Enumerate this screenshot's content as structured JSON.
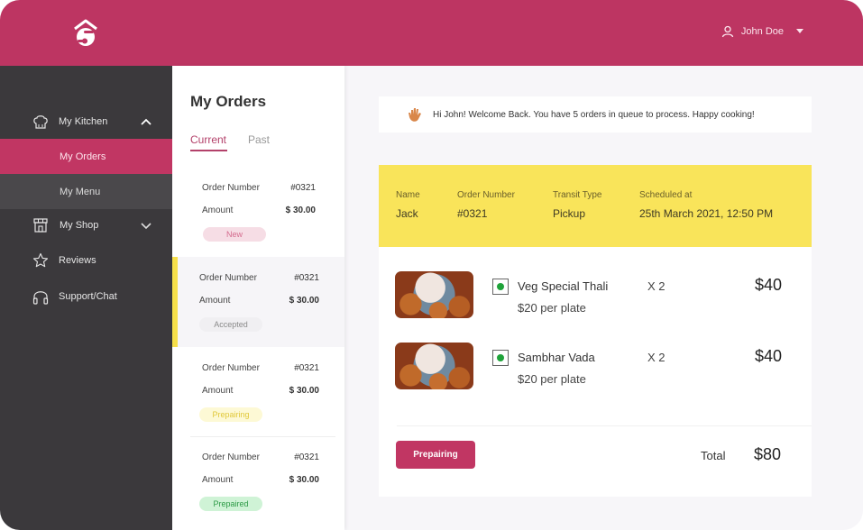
{
  "header": {
    "logo": "chef-hat-logo-icon",
    "user_name": "John Doe",
    "user_icon": "user-icon",
    "dropdown_icon": "caret-down-icon"
  },
  "sidebar": {
    "items": [
      {
        "label": "My Kitchen",
        "icon": "chef-hat-icon",
        "expanded": true,
        "children": [
          {
            "label": "My Orders",
            "active": true
          },
          {
            "label": "My Menu",
            "active": false
          }
        ]
      },
      {
        "label": "My Shop",
        "icon": "shop-icon",
        "expanded": false
      },
      {
        "label": "Reviews",
        "icon": "star-icon"
      },
      {
        "label": "Support/Chat",
        "icon": "headphones-icon"
      }
    ]
  },
  "orders_panel": {
    "title": "My Orders",
    "tabs": [
      {
        "label": "Current",
        "active": true
      },
      {
        "label": "Past",
        "active": false
      }
    ],
    "orders": [
      {
        "order_number_label": "Order Number",
        "order_number": "#0321",
        "amount_label": "Amount",
        "amount": "$ 30.00",
        "status": "New"
      },
      {
        "order_number_label": "Order Number",
        "order_number": "#0321",
        "amount_label": "Amount",
        "amount": "$ 30.00",
        "status": "Accepted",
        "selected": true
      },
      {
        "order_number_label": "Order Number",
        "order_number": "#0321",
        "amount_label": "Amount",
        "amount": "$ 30.00",
        "status": "Prepairing"
      },
      {
        "order_number_label": "Order Number",
        "order_number": "#0321",
        "amount_label": "Amount",
        "amount": "$ 30.00",
        "status": "Prepaired"
      }
    ]
  },
  "welcome": {
    "icon": "waving-hand-icon",
    "text": "Hi John! Welcome Back. You have 5 orders in queue to process. Happy cooking!"
  },
  "order_detail": {
    "header": [
      {
        "key": "Name",
        "value": "Jack"
      },
      {
        "key": "Order Number",
        "value": "#0321"
      },
      {
        "key": "Transit Type",
        "value": "Pickup"
      },
      {
        "key": "Scheduled at",
        "value": "25th March 2021, 12:50 PM"
      }
    ],
    "items": [
      {
        "name": "Veg Special Thali",
        "unit_price": "$20 per plate",
        "qty": "X 2",
        "price": "$40",
        "veg": true
      },
      {
        "name": "Sambhar Vada",
        "unit_price": "$20 per plate",
        "qty": "X 2",
        "price": "$40",
        "veg": true
      }
    ],
    "status_button": "Prepairing",
    "total_label": "Total",
    "total_value": "$80"
  },
  "colors": {
    "brand": "#bd3562",
    "sidebar": "#3b393c",
    "highlight_yellow": "#f9e45a",
    "veg_green": "#1fa33a"
  }
}
